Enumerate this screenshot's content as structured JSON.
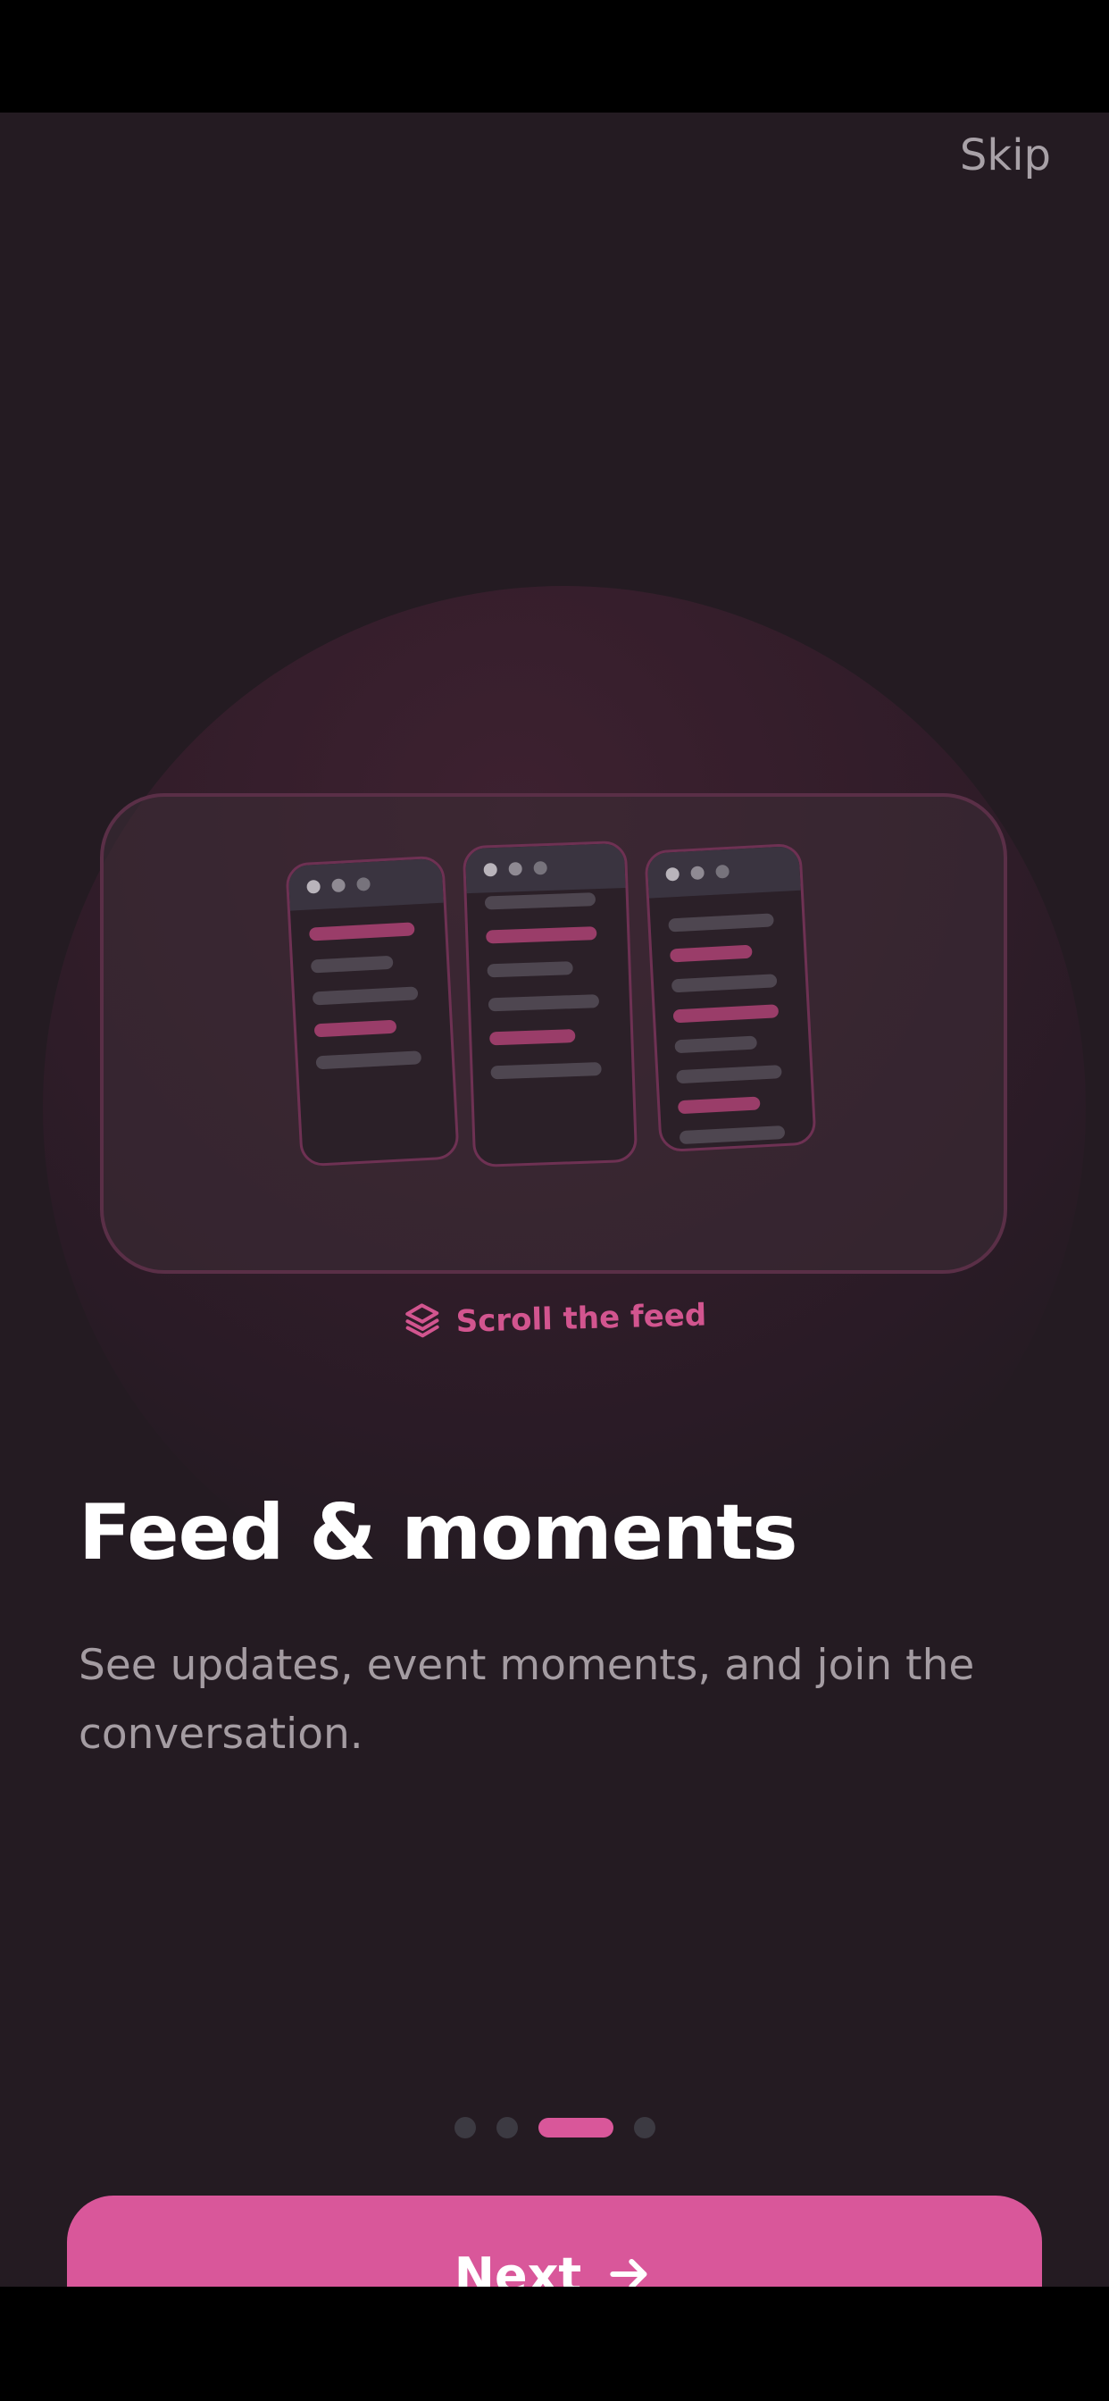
{
  "header": {
    "skip_label": "Skip"
  },
  "illustration": {
    "caption": "Scroll the feed",
    "caption_icon": "layers-icon"
  },
  "content": {
    "title": "Feed & moments",
    "description": "See updates, event moments, and join the conversation."
  },
  "pagination": {
    "total": 4,
    "active_index": 2
  },
  "footer": {
    "next_label": "Next",
    "next_icon": "arrow-right-icon"
  },
  "colors": {
    "background": "#241b22",
    "accent": "#d9579a",
    "title": "#ffffff",
    "muted_text": "#a49ca2"
  }
}
